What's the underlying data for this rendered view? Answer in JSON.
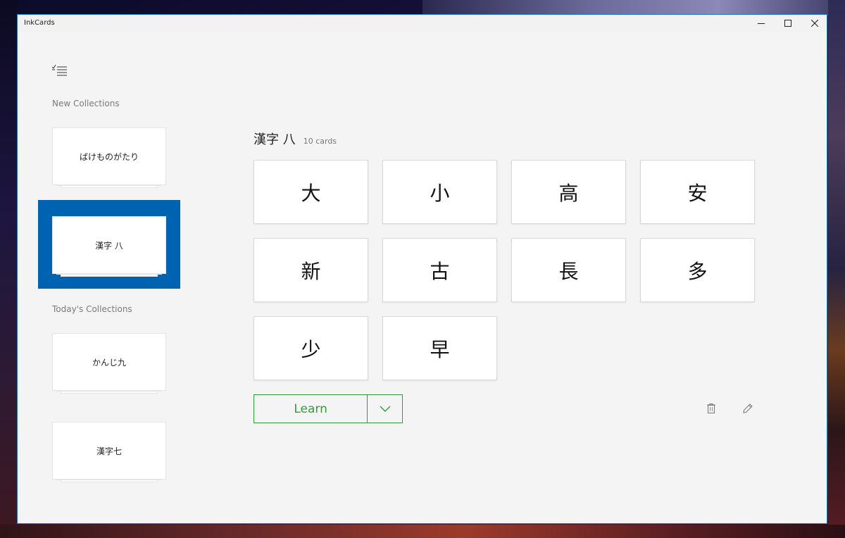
{
  "window": {
    "title": "InkCards"
  },
  "sidebar": {
    "new_label": "New Collections",
    "today_label": "Today's Collections",
    "new_collections": [
      "ばけものがたり",
      "漢字 八"
    ],
    "today_collections": [
      "かんじ九",
      "漢字七"
    ],
    "selected": "漢字 八"
  },
  "main": {
    "collection_name": "漢字 八",
    "card_count": "10 cards",
    "cards": [
      "大",
      "小",
      "高",
      "安",
      "新",
      "古",
      "長",
      "多",
      "少",
      "早"
    ],
    "learn_label": "Learn"
  },
  "colors": {
    "accent": "#0063b1",
    "learn_green": "#2f9e3a",
    "window_border": "#1e78c8"
  },
  "icons": [
    "menu-list-icon",
    "minimize-icon",
    "maximize-icon",
    "close-icon",
    "chevron-down-icon",
    "delete-icon",
    "edit-icon"
  ]
}
